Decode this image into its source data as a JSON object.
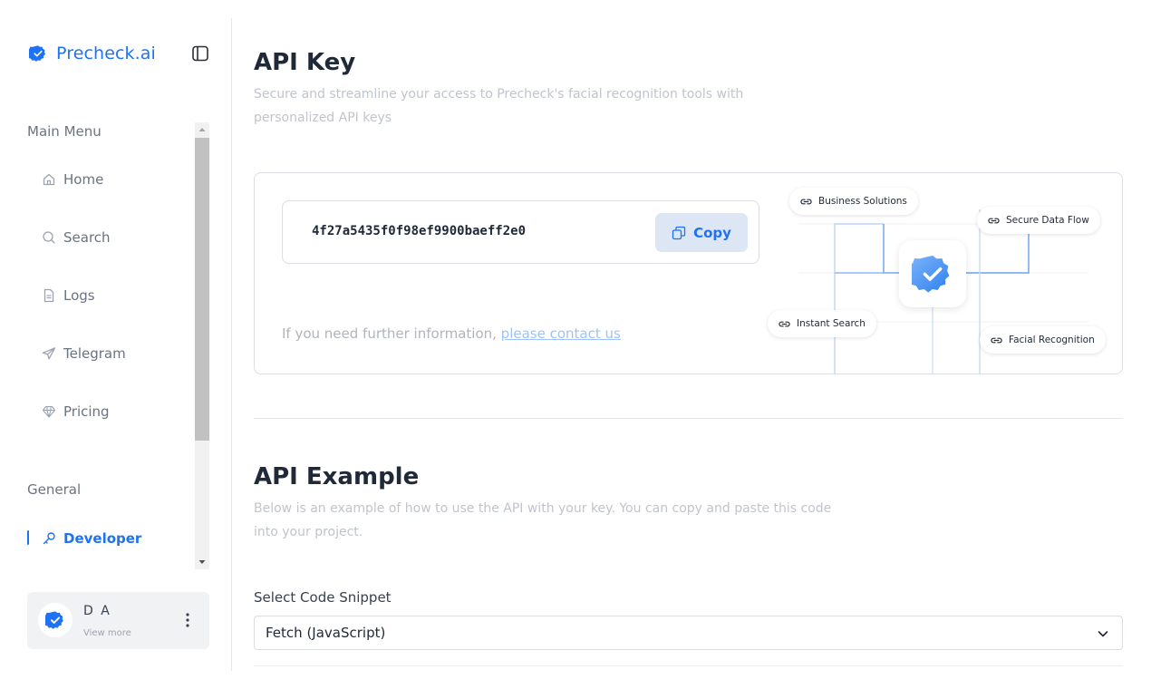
{
  "app": {
    "brand": "Precheck.ai",
    "accent_color": "#1d72f5"
  },
  "sidebar": {
    "main_menu_title": "Main Menu",
    "items": [
      {
        "label": "Home",
        "icon": "home-icon"
      },
      {
        "label": "Search",
        "icon": "search-icon"
      },
      {
        "label": "Logs",
        "icon": "document-icon"
      },
      {
        "label": "Telegram",
        "icon": "send-icon"
      },
      {
        "label": "Pricing",
        "icon": "diamond-icon"
      }
    ],
    "general_title": "General",
    "general_items": [
      {
        "label": "Developer",
        "icon": "key-icon",
        "active": true
      }
    ]
  },
  "user": {
    "name": "D A",
    "sub": "View more"
  },
  "api_key_section": {
    "title": "API Key",
    "subtitle": "Secure and streamline your access to Precheck's facial recognition tools with personalized API keys",
    "key_value": "4f27a5435f0f98ef9900baeff2e0",
    "copy_label": "Copy",
    "info_text": "If you need further information, ",
    "info_link": "please contact us",
    "illustration_labels": {
      "business": "Business Solutions",
      "secure": "Secure Data Flow",
      "instant": "Instant Search",
      "facial": "Facial Recognition"
    }
  },
  "api_example_section": {
    "title": "API Example",
    "subtitle": "Below is an example of how to use the API with your key. You can copy and paste this code into your project.",
    "select_label": "Select Code Snippet",
    "select_value": "Fetch (JavaScript)"
  }
}
